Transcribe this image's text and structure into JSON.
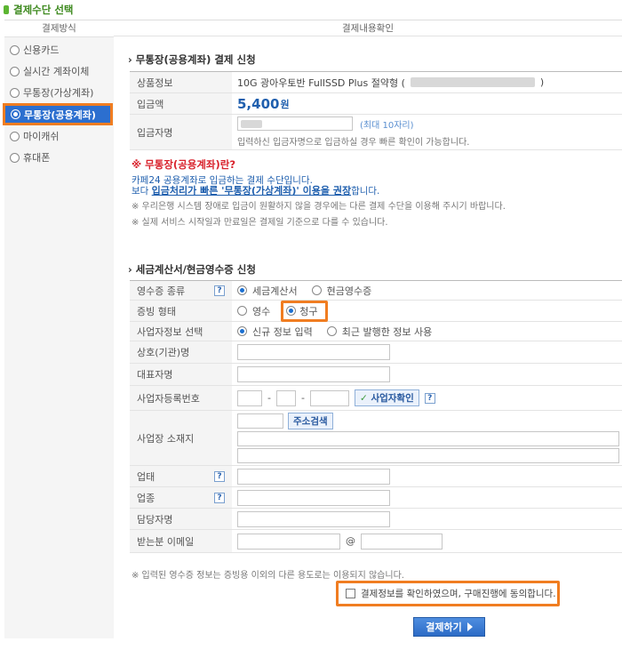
{
  "page_title": "결제수단 선택",
  "sidebar": {
    "header": "결제방식",
    "items": [
      {
        "label": "신용카드",
        "selected": false
      },
      {
        "label": "실시간 계좌이체",
        "selected": false
      },
      {
        "label": "무통장(가상계좌)",
        "selected": false
      },
      {
        "label": "무통장(공용계좌)",
        "selected": true
      },
      {
        "label": "마이캐쉬",
        "selected": false
      },
      {
        "label": "휴대폰",
        "selected": false
      }
    ]
  },
  "main": {
    "header": "결제내용확인",
    "deposit": {
      "title": "무통장(공용계좌) 결제 신청",
      "product_label": "상품정보",
      "product_value": "10G 광아우토반 FullSSD Plus 절약형 (",
      "product_close": ")",
      "amount_label": "입금액",
      "amount_value": "5,400",
      "amount_unit": "원",
      "depositor_label": "입금자명",
      "depositor_limit": "(최대 10자리)",
      "depositor_note": "입력하신 입금자명으로 입금하실 경우 빠른 확인이 가능합니다."
    },
    "info": {
      "title": "※ 무통장(공용계좌)란?",
      "line1": "카페24 공용계좌로 입금하는 결제 수단입니다.",
      "line2_prefix": "보다 ",
      "line2_strong": "입금처리가 빠른 '무통장(가상계좌)' 이용을 권장",
      "line2_suffix": "합니다.",
      "note1": "※ 우리은행 시스템 장애로 입금이 원활하지 않을 경우에는 다른 결제 수단을 이용해 주시기 바랍니다.",
      "note2": "※ 실제 서비스 시작일과 만료일은 결제일 기준으로 다를 수 있습니다."
    },
    "receipt": {
      "title": "세금계산서/현금영수증 신청",
      "type_label": "영수증 종류",
      "type_options": [
        "세금계산서",
        "현금영수증"
      ],
      "proof_label": "증빙 형태",
      "proof_options": [
        "영수",
        "청구"
      ],
      "biz_select_label": "사업자정보 선택",
      "biz_select_options": [
        "신규 정보 입력",
        "최근 발행한 정보 사용"
      ],
      "company_label": "상호(기관)명",
      "ceo_label": "대표자명",
      "regno_label": "사업자등록번호",
      "regno_dash": "-",
      "verify_button": "사업자확인",
      "address_label": "사업장 소재지",
      "address_search_button": "주소검색",
      "business_type_label": "업태",
      "business_item_label": "업종",
      "manager_label": "담당자명",
      "email_label": "받는분 이메일",
      "email_at": "@",
      "footnote": "※ 입력된 영수증 정보는 증빙용 이외의 다른 용도로는 이용되지 않습니다."
    },
    "agree_label": "결제정보를 확인하였으며, 구매진행에 동의합니다.",
    "submit_label": "결제하기"
  },
  "colors": {
    "accent": "#2c6fcf",
    "highlight": "#f07d21",
    "price": "#1f5fae",
    "warning": "#d9232d"
  },
  "icons": {
    "question": "?",
    "check": "✓"
  }
}
